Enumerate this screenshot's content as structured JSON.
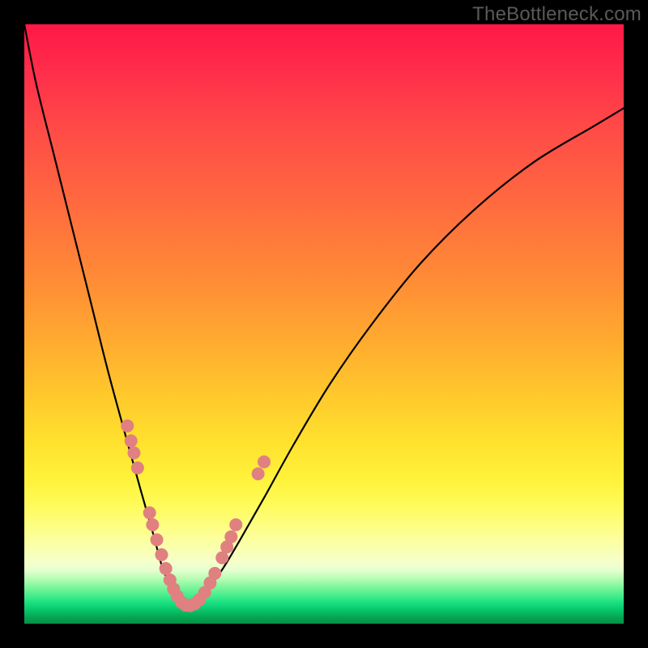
{
  "watermark": "TheBottleneck.com",
  "colors": {
    "frame": "#000000",
    "curve": "#000000",
    "beads": "#e08080"
  },
  "chart_data": {
    "type": "line",
    "title": "",
    "xlabel": "",
    "ylabel": "",
    "xlim": [
      0,
      100
    ],
    "ylim": [
      0,
      100
    ],
    "note": "No numeric axis labels are visible; the plot shows a V-shaped curve on a red-to-green vertical gradient with scattered beads along the lower portion of the curve.",
    "series": [
      {
        "name": "left-branch",
        "x": [
          0,
          2,
          5,
          8,
          11,
          14,
          17,
          19.5,
          21.5,
          23,
          24.5,
          25.5,
          26.2,
          26.8
        ],
        "y": [
          100,
          90,
          78,
          66,
          54,
          42,
          31,
          22,
          15,
          9.5,
          6,
          4,
          3,
          3
        ]
      },
      {
        "name": "right-branch",
        "x": [
          26.8,
          28,
          30,
          33,
          36,
          40,
          45,
          51,
          58,
          66,
          75,
          85,
          95,
          100
        ],
        "y": [
          3,
          3.2,
          5,
          9,
          14,
          21,
          30,
          40,
          50,
          60,
          69,
          77,
          83,
          86
        ]
      }
    ],
    "beads": [
      {
        "x": 17.2,
        "y": 33
      },
      {
        "x": 17.8,
        "y": 30.5
      },
      {
        "x": 18.3,
        "y": 28.5
      },
      {
        "x": 18.9,
        "y": 26
      },
      {
        "x": 20.9,
        "y": 18.5
      },
      {
        "x": 21.4,
        "y": 16.5
      },
      {
        "x": 22.1,
        "y": 14
      },
      {
        "x": 22.9,
        "y": 11.5
      },
      {
        "x": 23.6,
        "y": 9.2
      },
      {
        "x": 24.3,
        "y": 7.3
      },
      {
        "x": 24.9,
        "y": 5.8
      },
      {
        "x": 25.5,
        "y": 4.6
      },
      {
        "x": 26.2,
        "y": 3.6
      },
      {
        "x": 26.9,
        "y": 3.1
      },
      {
        "x": 27.6,
        "y": 3.0
      },
      {
        "x": 28.4,
        "y": 3.3
      },
      {
        "x": 29.2,
        "y": 4.0
      },
      {
        "x": 30.1,
        "y": 5.2
      },
      {
        "x": 31.0,
        "y": 6.8
      },
      {
        "x": 31.8,
        "y": 8.4
      },
      {
        "x": 33.0,
        "y": 11
      },
      {
        "x": 33.8,
        "y": 12.8
      },
      {
        "x": 34.5,
        "y": 14.5
      },
      {
        "x": 35.3,
        "y": 16.5
      },
      {
        "x": 39.0,
        "y": 25
      },
      {
        "x": 40.0,
        "y": 27
      }
    ]
  }
}
